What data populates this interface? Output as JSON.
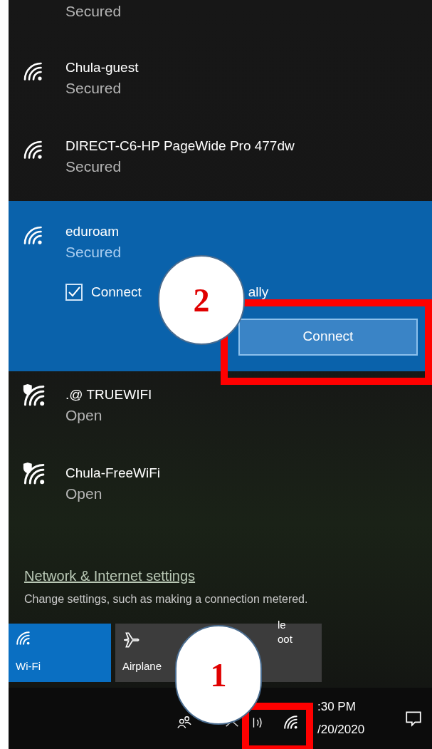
{
  "networks": [
    {
      "status": "Secured",
      "selected": false
    },
    {
      "name": "Chula-guest",
      "status": "Secured",
      "kind": "secured",
      "selected": false
    },
    {
      "name": "DIRECT-C6-HP PageWide Pro 477dw",
      "status": "Secured",
      "kind": "secured",
      "selected": false
    },
    {
      "name": "eduroam",
      "status": "Secured",
      "kind": "secured",
      "selected": true,
      "auto_connect": {
        "checked": true,
        "label_parts": [
          "Connect",
          "ally"
        ]
      },
      "button": "Connect"
    },
    {
      "name": ".@ TRUEWIFI",
      "status": "Open",
      "kind": "open",
      "selected": false
    },
    {
      "name": "Chula-FreeWiFi",
      "status": "Open",
      "kind": "open",
      "selected": false
    }
  ],
  "settings": {
    "link": "Network & Internet settings",
    "description": "Change settings, such as making a connection metered."
  },
  "tiles": [
    {
      "kind": "wifi",
      "label": "Wi-Fi",
      "on": true
    },
    {
      "kind": "airplane",
      "label": "Airplane",
      "on": false
    },
    {
      "kind": "hotspot",
      "label_parts": [
        "le",
        "oot"
      ],
      "on": false
    }
  ],
  "taskbar": {
    "time": ":30 PM",
    "date": "/20/2020"
  },
  "callouts": [
    {
      "number": "2"
    },
    {
      "number": "1"
    }
  ]
}
